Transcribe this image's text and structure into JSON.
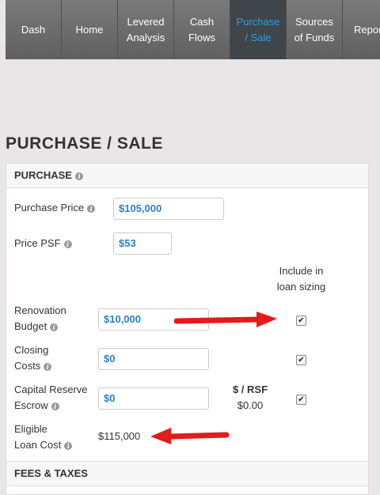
{
  "nav": {
    "tabs": [
      {
        "label": "Dash"
      },
      {
        "label": "Home"
      },
      {
        "label": "Levered Analysis"
      },
      {
        "label": "Cash Flows"
      },
      {
        "label": "Purchase / Sale",
        "active": true
      },
      {
        "label": "Sources of Funds"
      },
      {
        "label": "Repor"
      }
    ]
  },
  "page_title": "PURCHASE / SALE",
  "purchase": {
    "header": "PURCHASE",
    "purchase_price": {
      "label": "Purchase Price",
      "value": "$105,000"
    },
    "price_psf": {
      "label": "Price PSF",
      "value": "$53"
    },
    "include_header": "Include in loan sizing",
    "renovation_budget": {
      "label_line1": "Renovation",
      "label_line2": "Budget",
      "value": "$10,000",
      "checked": true
    },
    "closing_costs": {
      "label_line1": "Closing",
      "label_line2": "Costs",
      "value": "$0",
      "checked": true
    },
    "capital_reserve": {
      "label_line1": "Capital Reserve",
      "label_line2": "Escrow",
      "value": "$0",
      "checked": true,
      "rsf_label": "$ / RSF",
      "rsf_value": "$0.00"
    },
    "eligible_loan_cost": {
      "label_line1": "Eligible",
      "label_line2": "Loan Cost",
      "value": "$115,000"
    }
  },
  "fees": {
    "header": "FEES & TAXES"
  },
  "colors": {
    "accent": "#2d9fe0",
    "arrow": "#e21b1b",
    "nav_bg": "#6b6b6b",
    "input_text": "#2d7fc1"
  },
  "icons": {
    "info": "info-icon",
    "checkbox": "checkmark-icon",
    "arrow": "red-arrow-annotation"
  }
}
